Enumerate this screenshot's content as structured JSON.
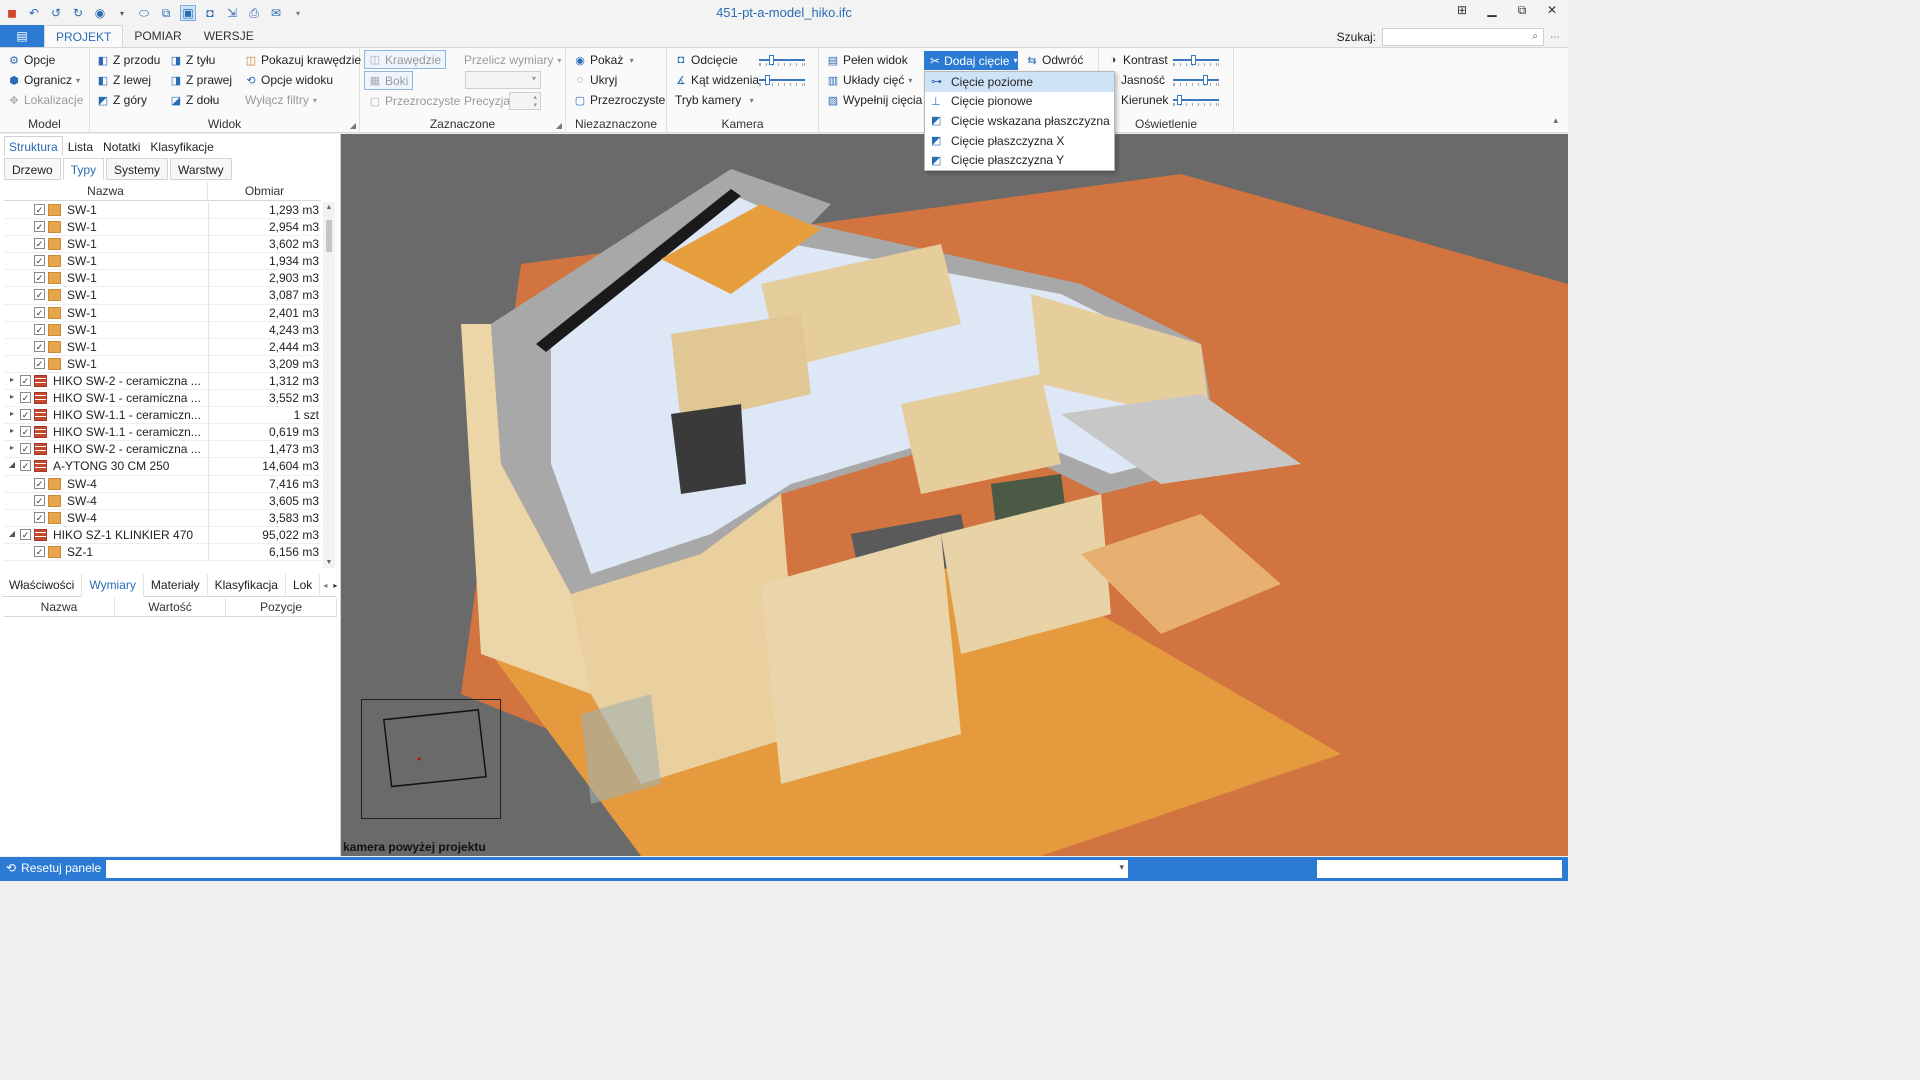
{
  "window": {
    "title": "451-pt-a-model_hiko.ifc"
  },
  "quick_access": [
    "app-icon",
    "undo-history-icon",
    "undo-icon",
    "redo-icon",
    "eye-icon",
    "dropdown-icon",
    "view-icon",
    "copy-icon",
    "model-view-icon",
    "camera-icon",
    "export-icon",
    "print-icon",
    "send-icon",
    "customize-icon"
  ],
  "tabs": {
    "file": "▤",
    "items": [
      "PROJEKT",
      "POMIAR",
      "WERSJE"
    ],
    "active": "PROJEKT"
  },
  "search": {
    "label": "Szukaj:",
    "placeholder": ""
  },
  "ribbon": {
    "model": {
      "label": "Model",
      "opcje": "Opcje",
      "ogranicz": "Ogranicz",
      "lokalizacje": "Lokalizacje"
    },
    "widok": {
      "label": "Widok",
      "z_przodu": "Z przodu",
      "z_lewej": "Z lewej",
      "z_gory": "Z góry",
      "z_tylu": "Z tyłu",
      "z_prawej": "Z prawej",
      "z_dolu": "Z dołu",
      "pokazuj_krawedzie": "Pokazuj krawędzie",
      "opcje_widoku": "Opcje widoku",
      "wylacz_filtry": "Wyłącz filtry"
    },
    "zaznaczone": {
      "label": "Zaznaczone",
      "krawedzie": "Krawędzie",
      "boki": "Boki",
      "przezroczyste": "Przezroczyste",
      "przelicz_wymiary": "Przelicz wymiary",
      "precyzja": "Precyzja"
    },
    "niezaznaczone": {
      "label": "Niezaznaczone",
      "pokaz": "Pokaż",
      "ukryj": "Ukryj",
      "przezroczyste": "Przezroczyste"
    },
    "kamera": {
      "label": "Kamera",
      "odciecie": "Odcięcie",
      "kat_widzenia": "Kąt widzenia",
      "tryb_kamery": "Tryb kamery"
    },
    "ciecia": {
      "pelen_widok": "Pełen widok",
      "uklady_ciec": "Układy cięć",
      "wypelnij_ciecia": "Wypełnij cięcia",
      "dodaj_ciecie": "Dodaj cięcie",
      "odwroc": "Odwróć"
    },
    "oswietlenie": {
      "label": "Oświetlenie",
      "kontrast": "Kontrast",
      "jasnosc": "Jasność",
      "kierunek": "Kierunek"
    }
  },
  "cut_menu": {
    "items": [
      "Cięcie poziome",
      "Cięcie pionowe",
      "Cięcie wskazana płaszczyzna",
      "Cięcie płaszczyzna X",
      "Cięcie płaszczyzna Y"
    ],
    "highlighted": "Cięcie poziome"
  },
  "left_panel": {
    "panel_tabs": [
      "Struktura",
      "Lista",
      "Notatki",
      "Klasyfikacje"
    ],
    "active_panel_tab": "Struktura",
    "sub_tabs": [
      "Drzewo",
      "Typy",
      "Systemy",
      "Warstwy"
    ],
    "active_sub_tab": "Typy",
    "columns": [
      "Nazwa",
      "Obmiar"
    ],
    "rows": [
      {
        "name": "SW-1",
        "value": "1,293 m3",
        "level": 2,
        "icon": "folder",
        "expand": ""
      },
      {
        "name": "SW-1",
        "value": "2,954 m3",
        "level": 2,
        "icon": "folder",
        "expand": ""
      },
      {
        "name": "SW-1",
        "value": "3,602 m3",
        "level": 2,
        "icon": "folder",
        "expand": ""
      },
      {
        "name": "SW-1",
        "value": "1,934 m3",
        "level": 2,
        "icon": "folder",
        "expand": ""
      },
      {
        "name": "SW-1",
        "value": "2,903 m3",
        "level": 2,
        "icon": "folder",
        "expand": ""
      },
      {
        "name": "SW-1",
        "value": "3,087 m3",
        "level": 2,
        "icon": "folder",
        "expand": ""
      },
      {
        "name": "SW-1",
        "value": "2,401 m3",
        "level": 2,
        "icon": "folder",
        "expand": ""
      },
      {
        "name": "SW-1",
        "value": "4,243 m3",
        "level": 2,
        "icon": "folder",
        "expand": ""
      },
      {
        "name": "SW-1",
        "value": "2,444 m3",
        "level": 2,
        "icon": "folder",
        "expand": ""
      },
      {
        "name": "SW-1",
        "value": "3,209 m3",
        "level": 2,
        "icon": "folder",
        "expand": ""
      },
      {
        "name": "HIKO SW-2 - ceramiczna ...",
        "value": "1,312 m3",
        "level": 1,
        "icon": "brick",
        "expand": "▸"
      },
      {
        "name": "HIKO SW-1 - ceramiczna ...",
        "value": "3,552 m3",
        "level": 1,
        "icon": "brick",
        "expand": "▸"
      },
      {
        "name": "HIKO SW-1.1 - ceramiczn...",
        "value": "1 szt",
        "level": 1,
        "icon": "brick",
        "expand": "▸"
      },
      {
        "name": "HIKO SW-1.1 - ceramiczn...",
        "value": "0,619 m3",
        "level": 1,
        "icon": "brick",
        "expand": "▸"
      },
      {
        "name": "HIKO SW-2 - ceramiczna ...",
        "value": "1,473 m3",
        "level": 1,
        "icon": "brick",
        "expand": "▸"
      },
      {
        "name": "A-YTONG 30 CM 250",
        "value": "14,604 m3",
        "level": 1,
        "icon": "brick",
        "expand": "◢"
      },
      {
        "name": "SW-4",
        "value": "7,416 m3",
        "level": 2,
        "icon": "folder",
        "expand": ""
      },
      {
        "name": "SW-4",
        "value": "3,605 m3",
        "level": 2,
        "icon": "folder",
        "expand": ""
      },
      {
        "name": "SW-4",
        "value": "3,583 m3",
        "level": 2,
        "icon": "folder",
        "expand": ""
      },
      {
        "name": "HIKO SZ-1 KLINKIER 470",
        "value": "95,022 m3",
        "level": 1,
        "icon": "brick",
        "expand": "◢"
      },
      {
        "name": "SZ-1",
        "value": "6,156 m3",
        "level": 2,
        "icon": "folder",
        "expand": ""
      }
    ],
    "bottom_tabs": [
      "Właściwości",
      "Wymiary",
      "Materiały",
      "Klasyfikacja",
      "Lok"
    ],
    "active_bottom_tab": "Wymiary",
    "property_columns": [
      "Nazwa",
      "Wartość",
      "Pozycje"
    ]
  },
  "viewport": {
    "camera_label": "kamera powyżej projektu"
  },
  "status": {
    "reset_label": "Resetuj panele"
  },
  "colors": {
    "accent": "#2b7bd4",
    "ground": "#d1743f",
    "floor": "#dde7f5",
    "wall": "#e9d3a6"
  }
}
